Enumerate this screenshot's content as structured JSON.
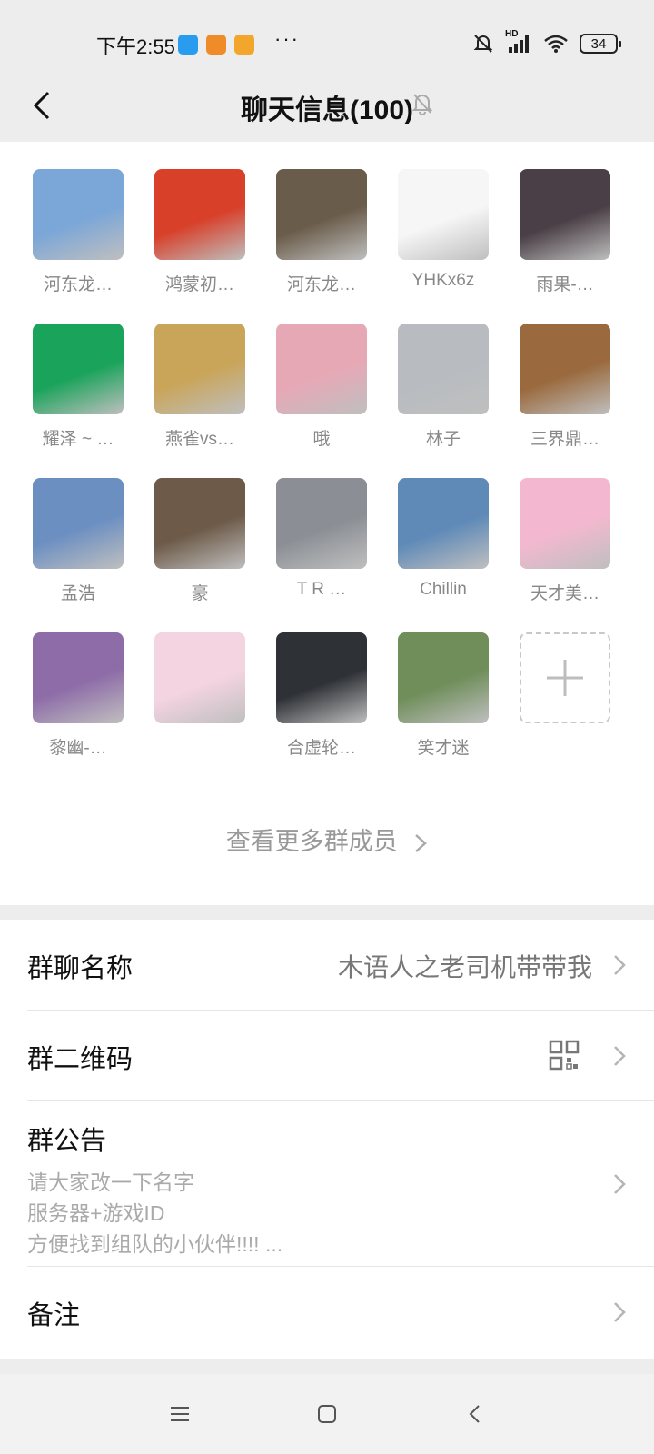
{
  "status_bar": {
    "time": "下午2:55",
    "more": "···",
    "battery": "34",
    "signal_label": "HD",
    "icons": [
      "bell-muted-icon",
      "signal-icon",
      "wifi-icon",
      "battery-icon"
    ]
  },
  "header": {
    "title": "聊天信息(100)",
    "back_icon": "chevron-left-icon",
    "mute_icon": "bell-muted-icon"
  },
  "members": [
    {
      "name": "河东龙…",
      "color": "#7aa6d8"
    },
    {
      "name": "鸿蒙初…",
      "color": "#d8402a"
    },
    {
      "name": "河东龙…",
      "color": "#6a5c4a"
    },
    {
      "name": "YHKx6z",
      "color": "#f6f6f6"
    },
    {
      "name": "雨果-…",
      "color": "#4a3f46"
    },
    {
      "name": "耀泽 ~ …",
      "color": "#1aa35a"
    },
    {
      "name": "燕雀vs…",
      "color": "#c9a55a"
    },
    {
      "name": "哦",
      "color": "#e7a8b6"
    },
    {
      "name": "林子",
      "color": "#b8bcc0"
    },
    {
      "name": "三界鼎…",
      "color": "#9a6a3e"
    },
    {
      "name": "孟浩",
      "color": "#6c8fc2"
    },
    {
      "name": "豪",
      "color": "#6d5a48"
    },
    {
      "name": "T R …",
      "color": "#8b8f95"
    },
    {
      "name": "Chillin",
      "color": "#5f8ab8"
    },
    {
      "name": "天才美…",
      "color": "#f3b8cf"
    },
    {
      "name": "黎幽-…",
      "color": "#8e6ca8"
    },
    {
      "name": "",
      "color": "#f5d4e2"
    },
    {
      "name": "合虚轮…",
      "color": "#2e3136"
    },
    {
      "name": "笑才迷",
      "color": "#6f8e5a"
    }
  ],
  "add_member_icon": "plus-icon",
  "more_members_label": "查看更多群成员",
  "settings": {
    "group_name_label": "群聊名称",
    "group_name_value": "木语人之老司机带带我",
    "qr_label": "群二维码",
    "qr_icon": "qr-code-icon",
    "notice_label": "群公告",
    "notice_lines": [
      "请大家改一下名字",
      "服务器+游戏ID",
      "方便找到组队的小伙伴!!!! ..."
    ],
    "remark_label": "备注"
  },
  "system_nav": {
    "menu_icon": "menu-icon",
    "home_icon": "home-icon",
    "back_icon": "back-icon"
  }
}
